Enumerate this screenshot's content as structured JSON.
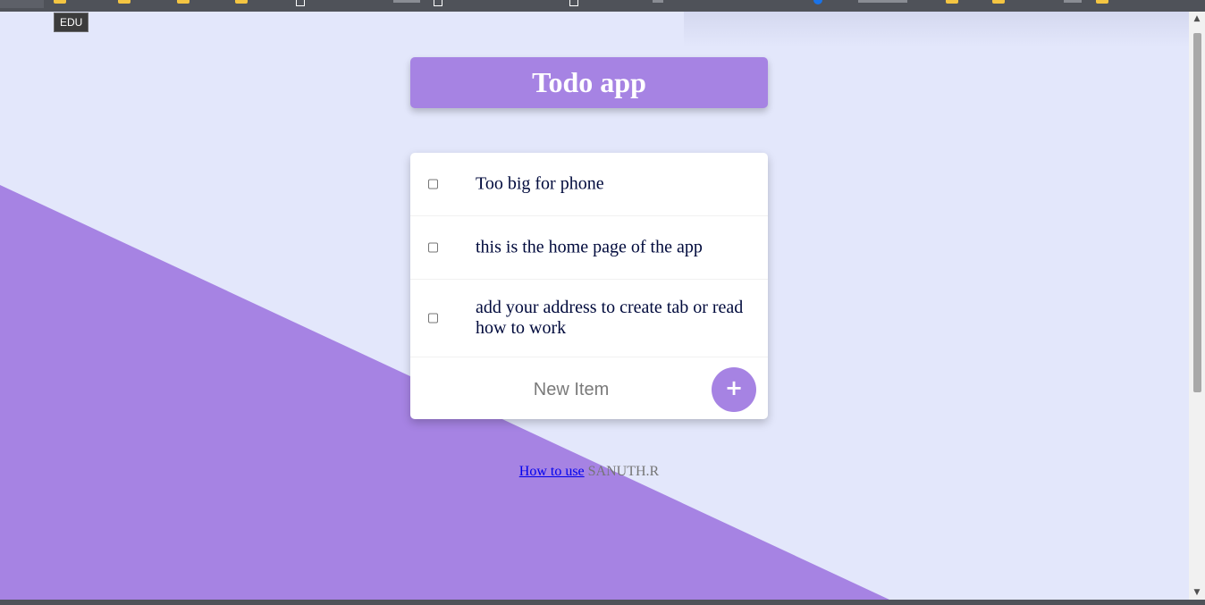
{
  "tooltip": "EDU",
  "header": {
    "title": "Todo app"
  },
  "items": [
    {
      "text": "Too big for phone",
      "checked": false
    },
    {
      "text": "this is the home page of the app",
      "checked": false
    },
    {
      "text": "add your address to create tab or read how to work",
      "checked": false
    }
  ],
  "new_item": {
    "placeholder": "New Item",
    "add_label": "+"
  },
  "footer": {
    "link_label": "How to use",
    "author": "SANUTH.R"
  },
  "colors": {
    "accent": "#A683E3",
    "background": "#E3E7FB",
    "text": "#000A3C",
    "link": "#0000EE"
  },
  "icons": {
    "bookmark_folder": "folder-icon",
    "bookmark_page": "page-icon",
    "add": "plus-icon"
  }
}
